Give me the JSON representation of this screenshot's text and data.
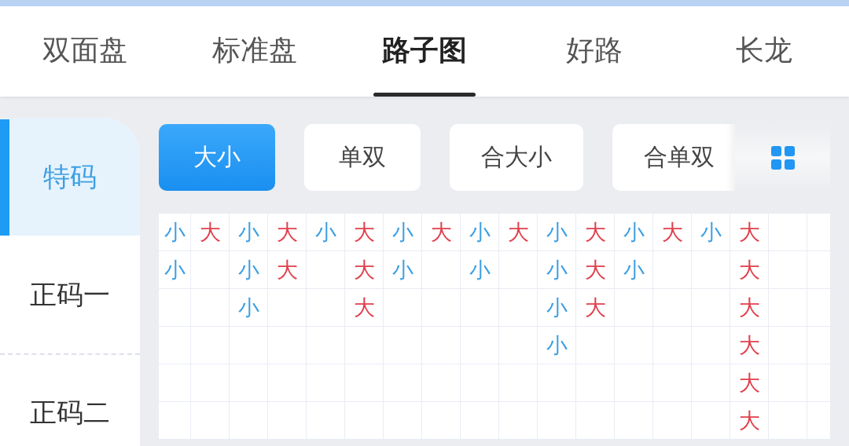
{
  "tabs": [
    {
      "label": "双面盘",
      "selected": false
    },
    {
      "label": "标准盘",
      "selected": false
    },
    {
      "label": "路子图",
      "selected": true
    },
    {
      "label": "好路",
      "selected": false
    },
    {
      "label": "长龙",
      "selected": false
    }
  ],
  "sidebar": {
    "items": [
      {
        "label": "特码",
        "selected": true
      },
      {
        "label": "正码一",
        "selected": false
      },
      {
        "label": "正码二",
        "selected": false
      }
    ]
  },
  "chips": [
    {
      "label": "大小",
      "selected": true
    },
    {
      "label": "单双",
      "selected": false
    },
    {
      "label": "合大小",
      "selected": false
    },
    {
      "label": "合单双",
      "selected": false
    }
  ],
  "road": {
    "columns": [
      {
        "color": "#3d9fe3",
        "cells": [
          "小",
          "小"
        ]
      },
      {
        "color": "#e0404c",
        "cells": [
          "大"
        ]
      },
      {
        "color": "#3d9fe3",
        "cells": [
          "小",
          "小",
          "小"
        ]
      },
      {
        "color": "#e0404c",
        "cells": [
          "大",
          "大"
        ]
      },
      {
        "color": "#3d9fe3",
        "cells": [
          "小"
        ]
      },
      {
        "color": "#e0404c",
        "cells": [
          "大",
          "大",
          "大"
        ]
      },
      {
        "color": "#3d9fe3",
        "cells": [
          "小",
          "小"
        ]
      },
      {
        "color": "#e0404c",
        "cells": [
          "大"
        ]
      },
      {
        "color": "#3d9fe3",
        "cells": [
          "小",
          "小"
        ]
      },
      {
        "color": "#e0404c",
        "cells": [
          "大"
        ]
      },
      {
        "color": "#3d9fe3",
        "cells": [
          "小",
          "小",
          "小",
          "小"
        ]
      },
      {
        "color": "#e0404c",
        "cells": [
          "大",
          "大",
          "大"
        ]
      },
      {
        "color": "#3d9fe3",
        "cells": [
          "小",
          "小"
        ]
      },
      {
        "color": "#e0404c",
        "cells": [
          "大"
        ]
      },
      {
        "color": "#3d9fe3",
        "cells": [
          "小"
        ]
      },
      {
        "color": "#e0404c",
        "cells": [
          "大",
          "大",
          "大",
          "大",
          "大",
          "大"
        ]
      }
    ]
  }
}
